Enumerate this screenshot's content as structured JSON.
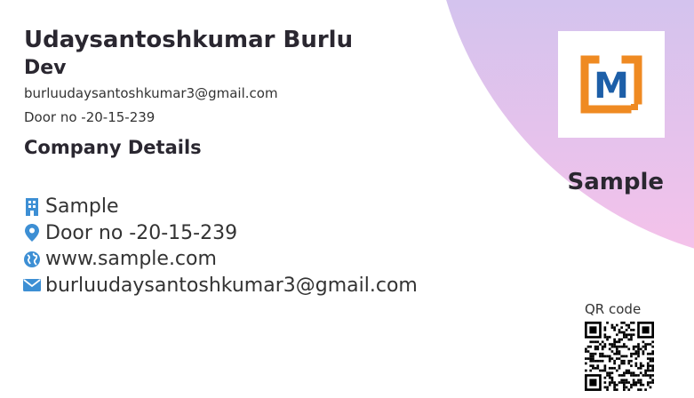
{
  "person": {
    "name": "Udaysantoshkumar Burlu",
    "role": "Dev",
    "email": "burluudaysantoshkumar3@gmail.com",
    "address": "Door no -20-15-239"
  },
  "company": {
    "section_title": "Company Details",
    "name": "Sample",
    "address": "Door no -20-15-239",
    "website": "www.sample.com",
    "email": "burluudaysantoshkumar3@gmail.com",
    "logo_letter": "M"
  },
  "qr": {
    "label": "QR code"
  },
  "colors": {
    "accent_icon": "#3d8fd4",
    "logo_orange": "#ef8a22",
    "logo_blue": "#1d5fa8",
    "gradient_top": "#a6bfec",
    "gradient_bottom": "#f6c2ea"
  },
  "icons": [
    "building-icon",
    "location-pin-icon",
    "globe-icon",
    "envelope-icon"
  ]
}
